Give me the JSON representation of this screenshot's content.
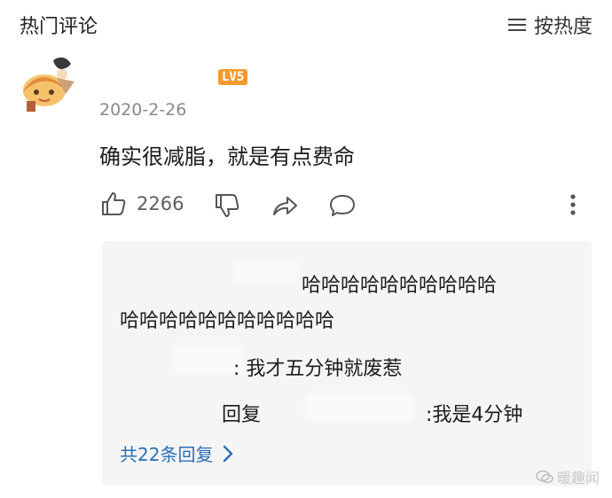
{
  "header": {
    "title": "热门评论",
    "sort_label": "按热度"
  },
  "comment": {
    "level": "LV5",
    "date": "2020-2-26",
    "text": "确实很减脂，就是有点费命",
    "likes": "2266"
  },
  "replies": {
    "reply1_line1": "哈哈哈哈哈哈哈哈哈哈",
    "reply1_line2": "哈哈哈哈哈哈哈哈哈哈哈",
    "reply2": ": 我才五分钟就废惹",
    "reply3_prefix": "回复",
    "reply3": ":我是4分钟",
    "more": "共22条回复"
  },
  "watermark": "暖趣闻"
}
